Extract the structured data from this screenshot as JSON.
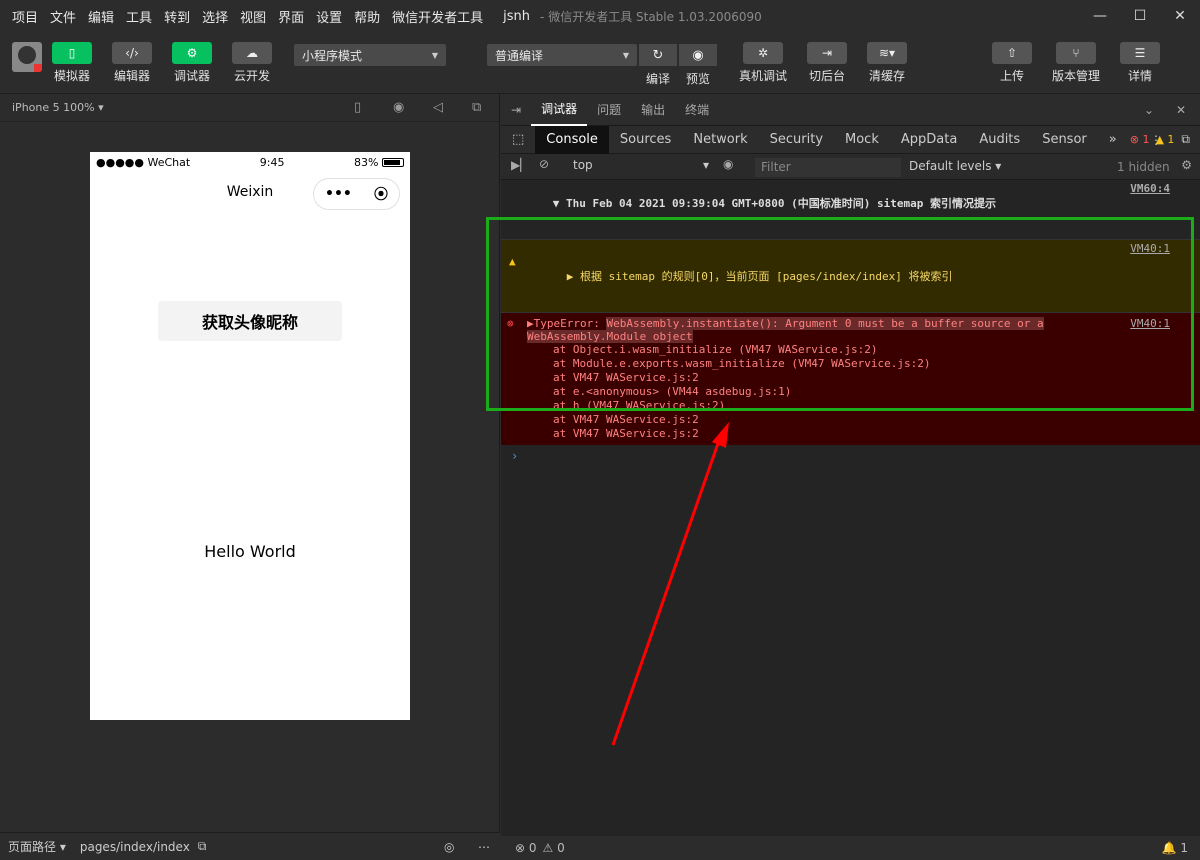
{
  "menubar": {
    "items": [
      "项目",
      "文件",
      "编辑",
      "工具",
      "转到",
      "选择",
      "视图",
      "界面",
      "设置",
      "帮助",
      "微信开发者工具"
    ],
    "project": "jsnh",
    "subtitle": "- 微信开发者工具 Stable 1.03.2006090"
  },
  "toolbar": {
    "simulator": "模拟器",
    "editor": "编辑器",
    "debugger": "调试器",
    "cloud": "云开发",
    "mode": "小程序模式",
    "compile_mode": "普通编译",
    "compile": "编译",
    "preview": "预览",
    "real_debug": "真机调试",
    "background": "切后台",
    "clear_cache": "清缓存",
    "upload": "上传",
    "version": "版本管理",
    "details": "详情"
  },
  "simulator": {
    "device": "iPhone 5 100% ▾",
    "carrier": "●●●●● WeChat",
    "time": "9:45",
    "battery": "83%",
    "nav_title": "Weixin",
    "button_label": "获取头像昵称",
    "hello": "Hello World"
  },
  "bottom": {
    "page_path_label": "页面路径 ▾",
    "page_path": "pages/index/index",
    "errors": "0",
    "warnings": "0",
    "notify_count": "1"
  },
  "devtools": {
    "tabs": [
      "调试器",
      "问题",
      "输出",
      "终端"
    ],
    "panels": [
      "Console",
      "Sources",
      "Network",
      "Security",
      "Mock",
      "AppData",
      "Audits",
      "Sensor"
    ],
    "error_count": "1",
    "warn_count": "1",
    "context": "top",
    "filter_placeholder": "Filter",
    "levels": "Default levels ▾",
    "hidden": "1 hidden"
  },
  "console": {
    "group_line": "▼ Thu Feb 04 2021 09:39:04 GMT+0800 (中国标准时间) sitemap 索引情况提示",
    "group_src": "VM60:4",
    "warn_line": "▶ 根据 sitemap 的规则[0]，当前页面 [pages/index/index] 将被索引",
    "warn_src": "VM40:1",
    "error_prefix": "▶TypeError: ",
    "error_msg1": "WebAssembly.instantiate(): Argument 0 must be a buffer source or a",
    "error_msg2": "WebAssembly.Module object",
    "error_src": "VM40:1",
    "trace": [
      "at Object.i.wasm_initialize (VM47 WAService.js:2)",
      "at Module.e.exports.wasm_initialize (VM47 WAService.js:2)",
      "at VM47 WAService.js:2",
      "at e.<anonymous> (VM44 asdebug.js:1)",
      "at h (VM47 WAService.js:2)",
      "at VM47 WAService.js:2",
      "at VM47 WAService.js:2"
    ],
    "prompt": "›"
  },
  "colors": {
    "accent": "#07c160",
    "highlight_box": "#1aad19",
    "arrow": "#ff0000"
  }
}
